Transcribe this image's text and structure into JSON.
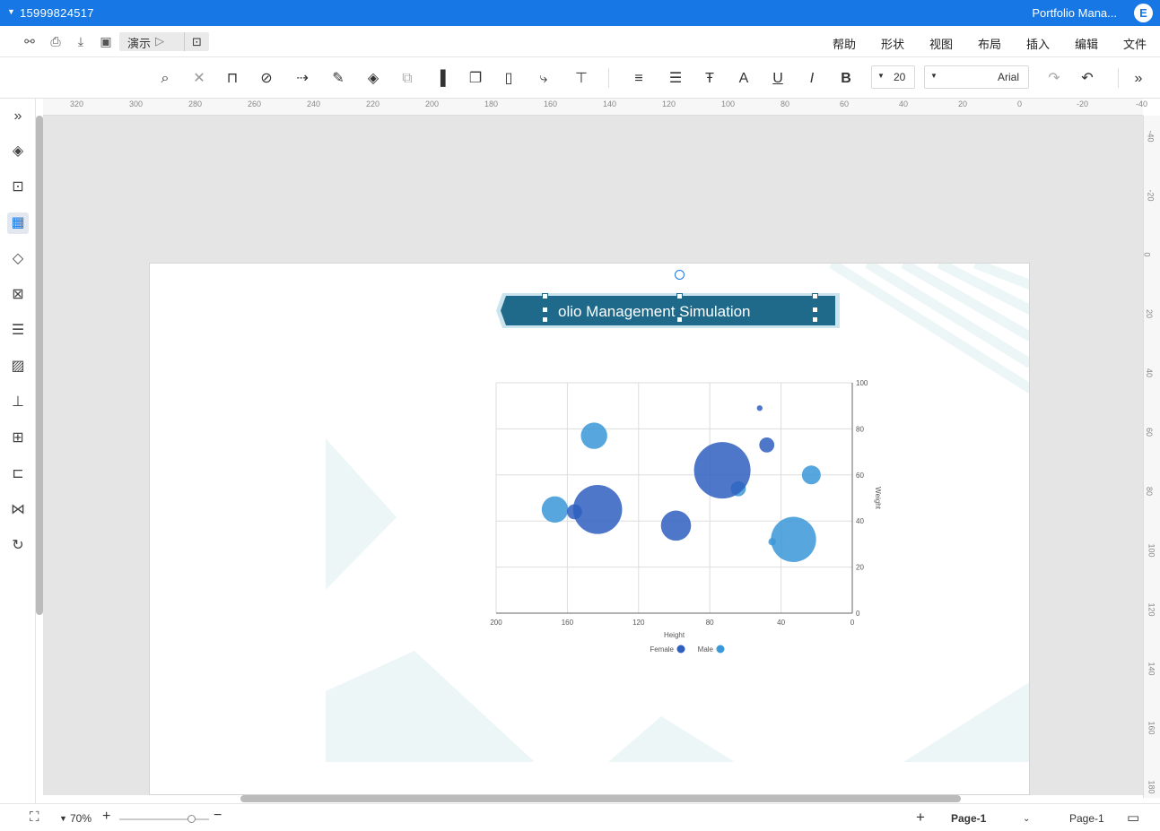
{
  "titlebar": {
    "user": "15999824517",
    "doc_title": "Portfolio Mana...",
    "logo": "E"
  },
  "menu": {
    "present_label": "演示",
    "items": [
      "帮助",
      "形状",
      "视图",
      "布局",
      "插入",
      "编辑",
      "文件"
    ]
  },
  "toolbar": {
    "font_family": "Arial",
    "font_size": "20"
  },
  "rulers": {
    "h_labels": [
      "320",
      "300",
      "280",
      "260",
      "240",
      "220",
      "200",
      "180",
      "160",
      "140",
      "120",
      "100",
      "80",
      "60",
      "40",
      "20",
      "0",
      "-20",
      "-40"
    ],
    "v_labels": [
      "-40",
      "-20",
      "0",
      "20",
      "40",
      "60",
      "80",
      "100",
      "120",
      "140",
      "160",
      "180"
    ]
  },
  "shape": {
    "title_text": "olio Management Simulation"
  },
  "status": {
    "zoom": "70%",
    "page_tab": "Page-1",
    "page_select": "Page-1"
  },
  "colors": {
    "accent": "#1677e5",
    "banner": "#1f6a8a",
    "male": "#3a98d8",
    "female": "#2f5fbf",
    "deco": "#e8f5f6"
  },
  "chart_data": {
    "type": "scatter",
    "variant": "bubble",
    "mirrored": true,
    "xlabel": "Height",
    "ylabel": "Weight",
    "xlim": [
      0,
      200
    ],
    "ylim": [
      0,
      100
    ],
    "x_ticks": [
      "200",
      "160",
      "120",
      "80",
      "40",
      "0"
    ],
    "y_ticks": [
      "100",
      "80",
      "60",
      "40",
      "20",
      "0"
    ],
    "grid": true,
    "legend_position": "bottom",
    "series": [
      {
        "name": "Male",
        "color": "#3a98d8",
        "points": [
          {
            "x": 145,
            "y": 77,
            "r": 7
          },
          {
            "x": 23,
            "y": 60,
            "r": 5
          },
          {
            "x": 167,
            "y": 45,
            "r": 7
          },
          {
            "x": 33,
            "y": 32,
            "r": 12
          },
          {
            "x": 45,
            "y": 31,
            "r": 2
          },
          {
            "x": 64,
            "y": 54,
            "r": 4
          }
        ]
      },
      {
        "name": "Female",
        "color": "#2f5fbf",
        "points": [
          {
            "x": 52,
            "y": 89,
            "r": 1.5
          },
          {
            "x": 48,
            "y": 73,
            "r": 4
          },
          {
            "x": 73,
            "y": 62,
            "r": 15
          },
          {
            "x": 143,
            "y": 45,
            "r": 13
          },
          {
            "x": 156,
            "y": 44,
            "r": 4
          },
          {
            "x": 99,
            "y": 38,
            "r": 8
          }
        ]
      }
    ]
  }
}
